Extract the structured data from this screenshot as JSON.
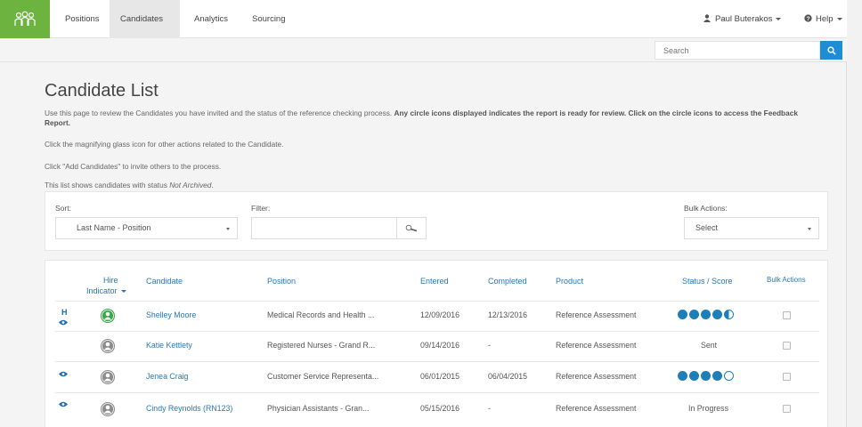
{
  "nav": {
    "items": [
      "Positions",
      "Candidates",
      "Analytics",
      "Sourcing"
    ],
    "user": "Paul Buterakos",
    "help": "Help"
  },
  "search": {
    "placeholder": "Search"
  },
  "page": {
    "title": "Candidate List",
    "desc1a": "Use this page to review the Candidates you have invited and the status of the reference checking process. ",
    "desc1b": "Any circle icons displayed indicates the report is ready for review. Click on the circle icons to access the Feedback Report.",
    "desc2": "Click the magnifying glass icon for other actions related to the Candidate.",
    "desc3": "Click \"Add Candidates\" to invite others to the process.",
    "desc4a": "This list shows candidates with status ",
    "desc4b": "Not Archived",
    "desc4c": "."
  },
  "controls": {
    "sort_label": "Sort:",
    "sort_value": "Last Name - Position",
    "filter_label": "Filter:",
    "filter_value": "",
    "bulk_label": "Bulk Actions:",
    "bulk_value": "Select"
  },
  "table": {
    "headers": {
      "hire": "Hire",
      "hire2": "Indicator",
      "candidate": "Candidate",
      "position": "Position",
      "entered": "Entered",
      "completed": "Completed",
      "product": "Product",
      "status": "Status / Score",
      "bulk": "Bulk Actions"
    },
    "rows": [
      {
        "flag": "H",
        "candidate": "Shelley Moore",
        "position": "Medical Records and Health ...",
        "entered": "12/09/2016",
        "completed": "12/13/2016",
        "product": "Reference Assessment",
        "status": ""
      },
      {
        "flag": "",
        "candidate": "Katie Kettlety",
        "position": "Registered Nurses - Grand R...",
        "entered": "09/14/2016",
        "completed": "-",
        "product": "Reference Assessment",
        "status": "Sent"
      },
      {
        "flag": "",
        "candidate": "Jenea Craig",
        "position": "Customer Service Representa...",
        "entered": "06/01/2015",
        "completed": "06/04/2015",
        "product": "Reference Assessment",
        "status": ""
      },
      {
        "flag": "",
        "candidate": "Cindy Reynolds (RN123)",
        "position": "Physician Assistants - Gran...",
        "entered": "05/15/2016",
        "completed": "-",
        "product": "Reference Assessment",
        "status": "In Progress"
      }
    ]
  },
  "colors": {
    "brand_green": "#6db33f",
    "accent_blue": "#1f8dd6",
    "link": "#2a78b8",
    "score": "#1e7fb8"
  }
}
